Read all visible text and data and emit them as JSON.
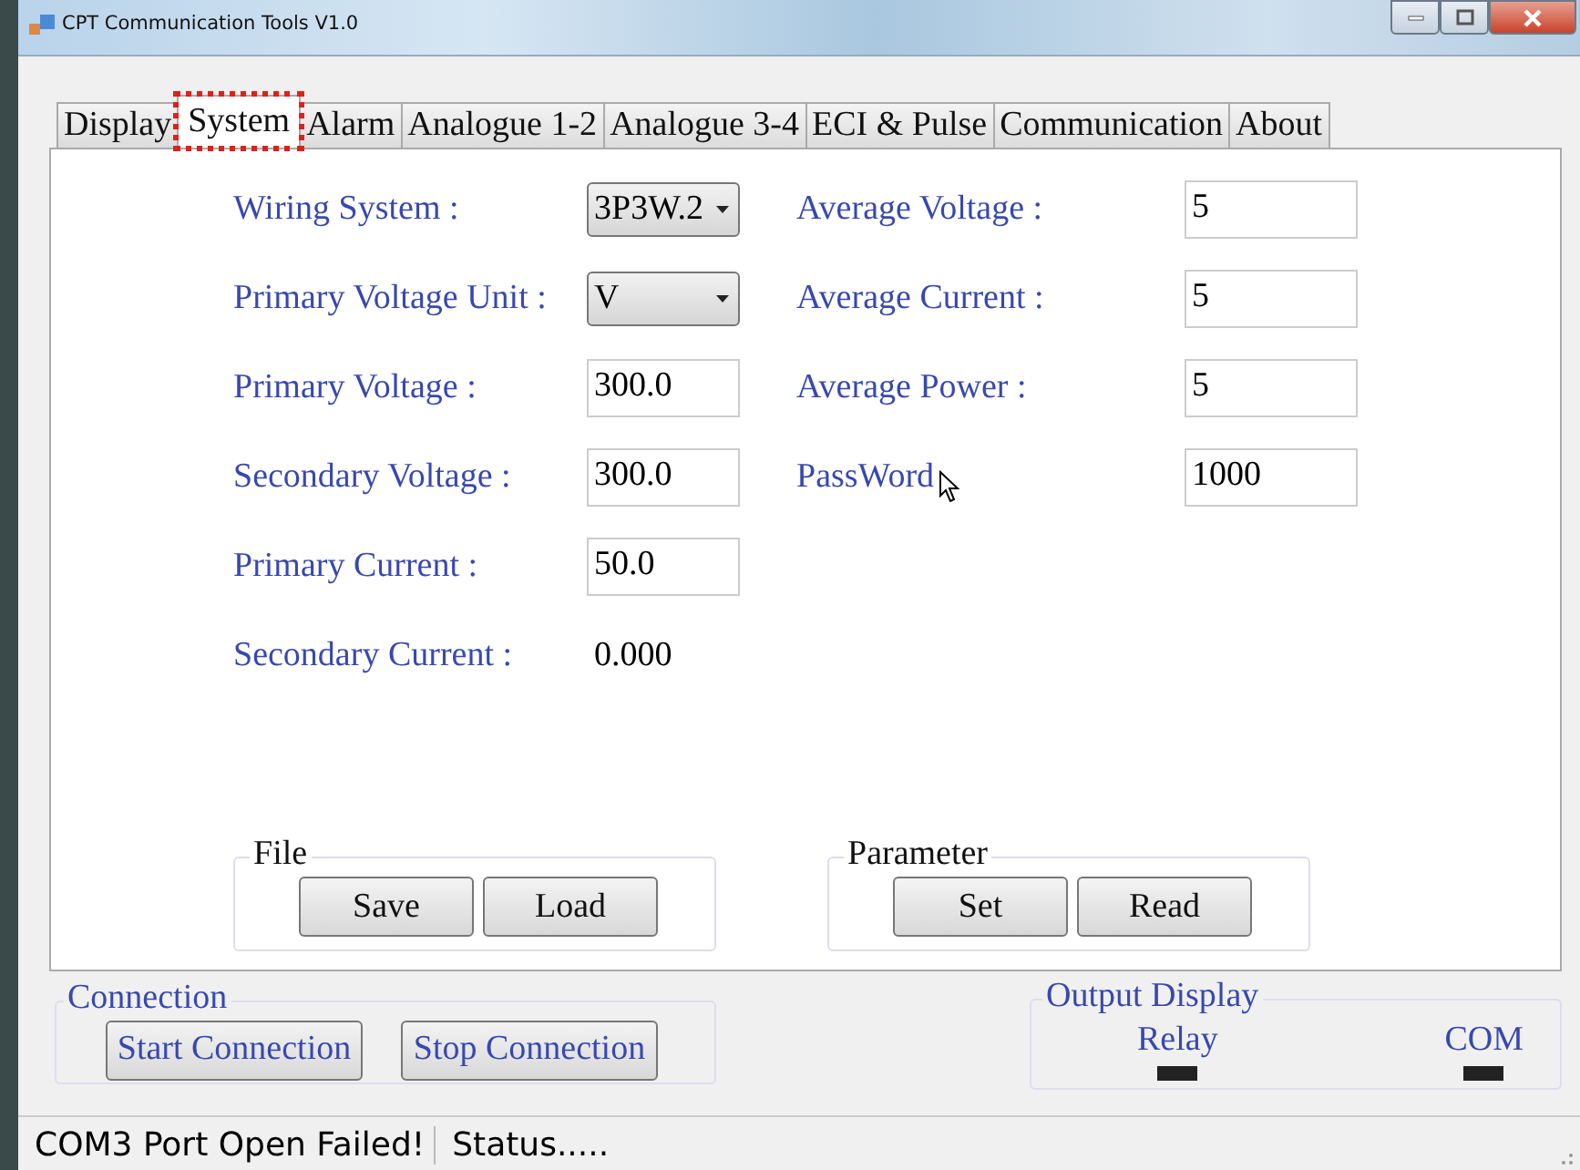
{
  "window": {
    "title": "CPT Communication Tools V1.0"
  },
  "tabs": [
    {
      "label": "Display",
      "selected": false,
      "highlighted": false
    },
    {
      "label": "System",
      "selected": true,
      "highlighted": true
    },
    {
      "label": "Alarm",
      "selected": false,
      "highlighted": false
    },
    {
      "label": "Analogue 1-2",
      "selected": false,
      "highlighted": false
    },
    {
      "label": "Analogue 3-4",
      "selected": false,
      "highlighted": false
    },
    {
      "label": "ECI & Pulse",
      "selected": false,
      "highlighted": false
    },
    {
      "label": "Communication",
      "selected": false,
      "highlighted": false
    },
    {
      "label": "About",
      "selected": false,
      "highlighted": false
    }
  ],
  "left_fields": [
    {
      "label": "Wiring System :",
      "kind": "dropdown",
      "value": "3P3W.2"
    },
    {
      "label": "Primary Voltage Unit :",
      "kind": "dropdown",
      "value": "V"
    },
    {
      "label": "Primary Voltage :",
      "kind": "input",
      "value": "300.0"
    },
    {
      "label": "Secondary Voltage :",
      "kind": "input",
      "value": "300.0"
    },
    {
      "label": "Primary Current :",
      "kind": "input",
      "value": "50.0"
    },
    {
      "label": "Secondary Current :",
      "kind": "readout",
      "value": "0.000"
    }
  ],
  "right_fields": [
    {
      "label": "Average Voltage :",
      "kind": "input",
      "value": "5",
      "cursor": false
    },
    {
      "label": "Average Current :",
      "kind": "input",
      "value": "5",
      "cursor": false
    },
    {
      "label": "Average Power :",
      "kind": "input",
      "value": "5",
      "cursor": false
    },
    {
      "label": "PassWord",
      "kind": "input",
      "value": "1000",
      "cursor": true
    }
  ],
  "groups": [
    {
      "title": "File",
      "buttons": [
        "Save",
        "Load"
      ]
    },
    {
      "title": "Parameter",
      "buttons": [
        "Set",
        "Read"
      ]
    }
  ],
  "connection": {
    "title": "Connection",
    "buttons": [
      "Start Connection",
      "Stop Connection"
    ]
  },
  "output_display": {
    "title": "Output Display",
    "indicators": [
      {
        "label": "Relay"
      },
      {
        "label": "COM"
      }
    ]
  },
  "status_bar": [
    "COM3 Port Open Failed!",
    "Status....."
  ]
}
